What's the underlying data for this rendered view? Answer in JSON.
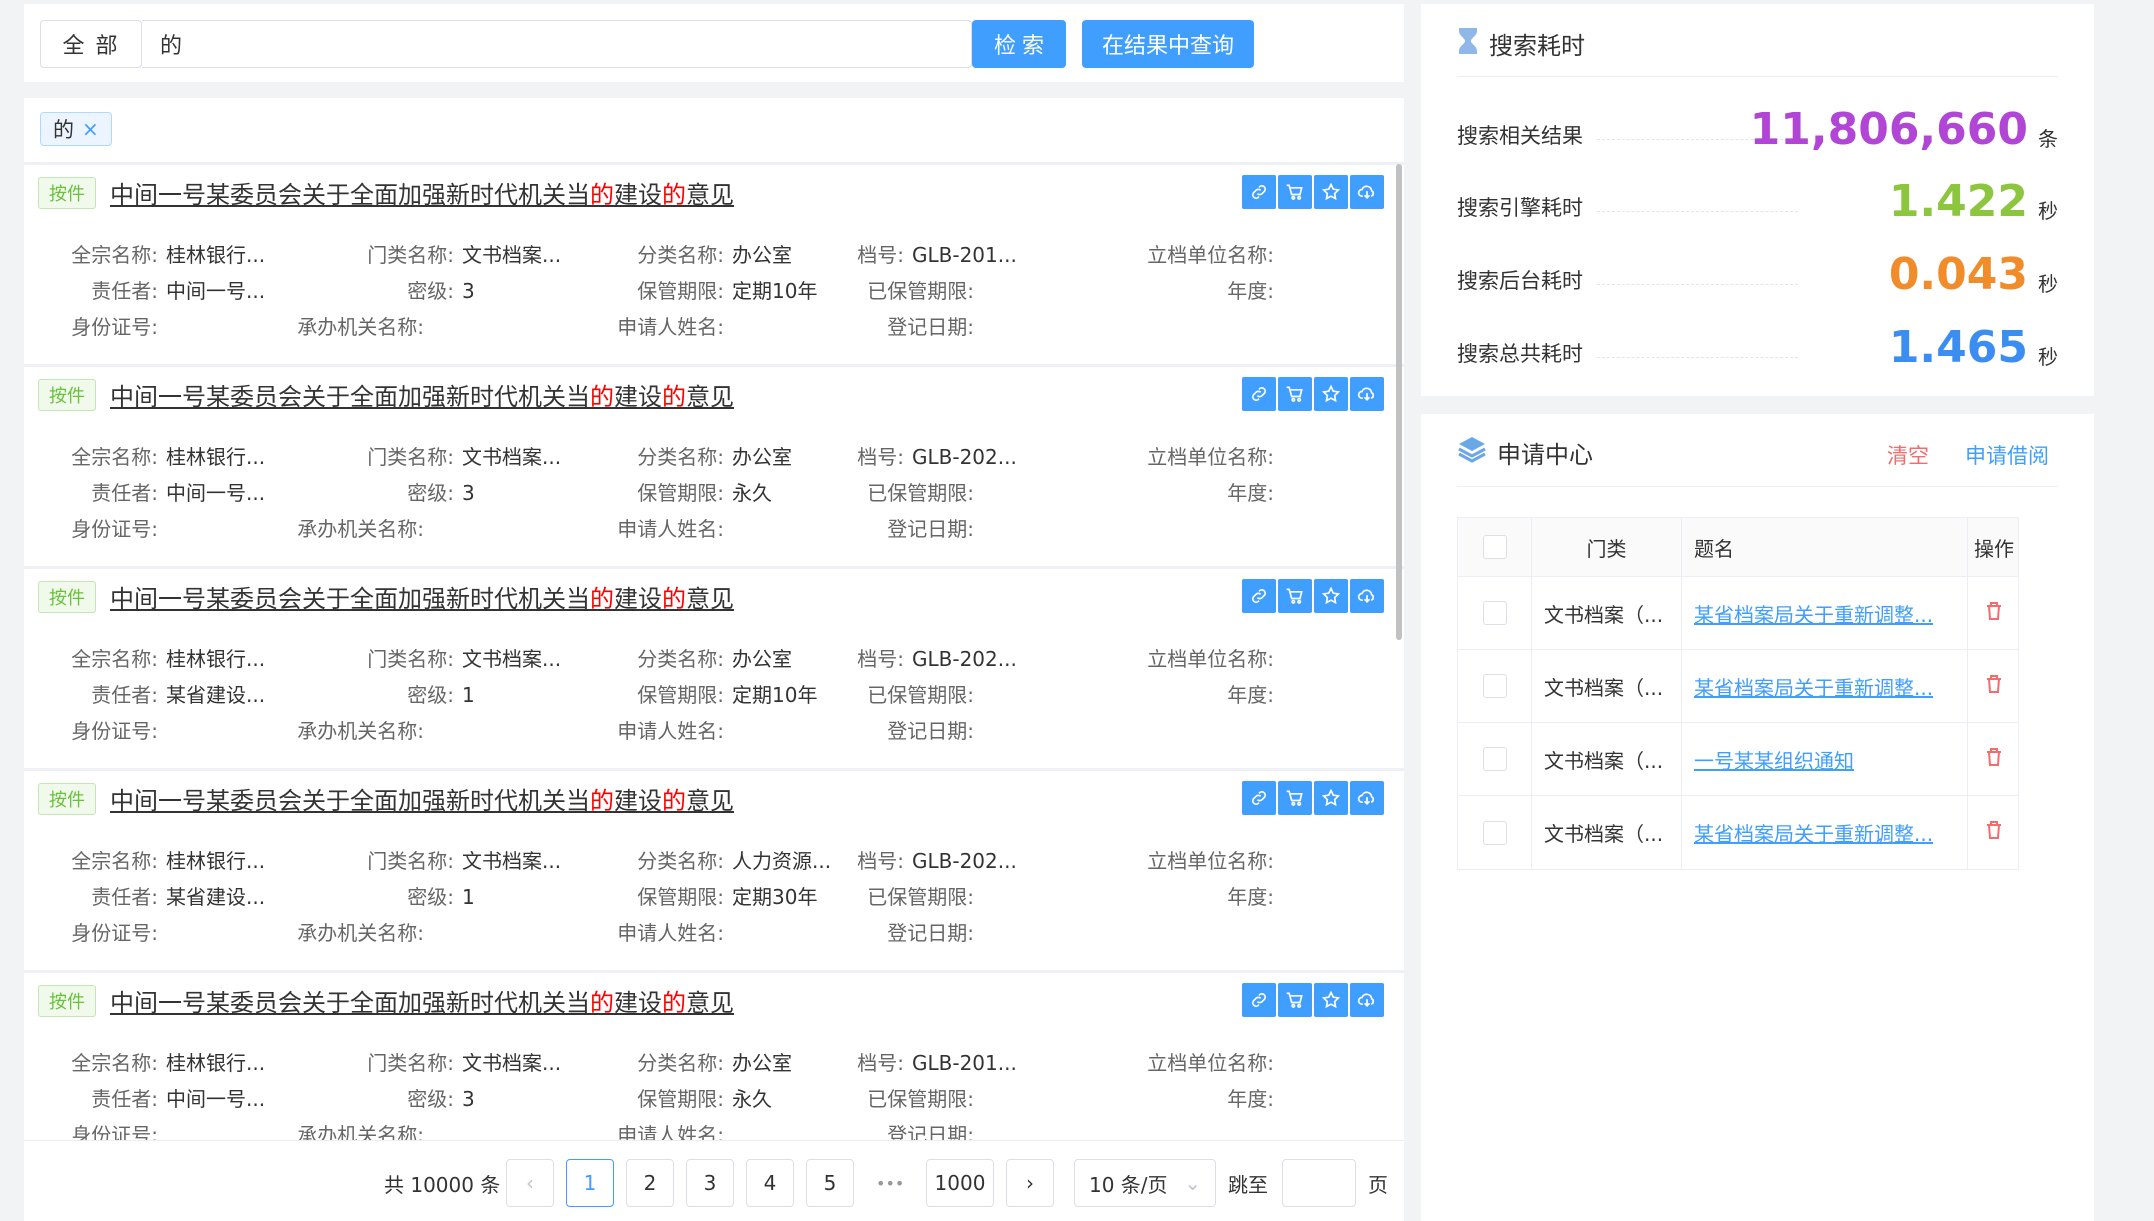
{
  "search": {
    "scope": "全 部",
    "query": "的",
    "search_label": "检 索",
    "refine_label": "在结果中查询"
  },
  "filter_tag": "的",
  "results": [
    {
      "badge": "按件",
      "title_a": "中间一号某委员会关于全面加强新时代机关当",
      "title_b": "的",
      "title_c": "建设",
      "title_d": "的",
      "title_e": "意见",
      "l1": [
        [
          "全宗名称:",
          "桂林银行..."
        ],
        [
          "门类名称:",
          "文书档案..."
        ],
        [
          "分类名称:",
          "办公室"
        ],
        [
          "档号:",
          "GLB-201..."
        ],
        [
          "立档单位名称:",
          ""
        ]
      ],
      "l2": [
        [
          "责任者:",
          "中间一号..."
        ],
        [
          "密级:",
          "3"
        ],
        [
          "保管期限:",
          "定期10年"
        ],
        [
          "已保管期限:",
          ""
        ],
        [
          "年度:",
          ""
        ]
      ],
      "l3": [
        [
          "身份证号:",
          ""
        ],
        [
          "承办机关名称:",
          ""
        ],
        [
          "申请人姓名:",
          ""
        ],
        [
          "登记日期:",
          ""
        ]
      ]
    },
    {
      "badge": "按件",
      "title_a": "中间一号某委员会关于全面加强新时代机关当",
      "title_b": "的",
      "title_c": "建设",
      "title_d": "的",
      "title_e": "意见",
      "l1": [
        [
          "全宗名称:",
          "桂林银行..."
        ],
        [
          "门类名称:",
          "文书档案..."
        ],
        [
          "分类名称:",
          "办公室"
        ],
        [
          "档号:",
          "GLB-202..."
        ],
        [
          "立档单位名称:",
          ""
        ]
      ],
      "l2": [
        [
          "责任者:",
          "中间一号..."
        ],
        [
          "密级:",
          "3"
        ],
        [
          "保管期限:",
          "永久"
        ],
        [
          "已保管期限:",
          ""
        ],
        [
          "年度:",
          ""
        ]
      ],
      "l3": [
        [
          "身份证号:",
          ""
        ],
        [
          "承办机关名称:",
          ""
        ],
        [
          "申请人姓名:",
          ""
        ],
        [
          "登记日期:",
          ""
        ]
      ]
    },
    {
      "badge": "按件",
      "title_a": "中间一号某委员会关于全面加强新时代机关当",
      "title_b": "的",
      "title_c": "建设",
      "title_d": "的",
      "title_e": "意见",
      "l1": [
        [
          "全宗名称:",
          "桂林银行..."
        ],
        [
          "门类名称:",
          "文书档案..."
        ],
        [
          "分类名称:",
          "办公室"
        ],
        [
          "档号:",
          "GLB-202..."
        ],
        [
          "立档单位名称:",
          ""
        ]
      ],
      "l2": [
        [
          "责任者:",
          "某省建设..."
        ],
        [
          "密级:",
          "1"
        ],
        [
          "保管期限:",
          "定期10年"
        ],
        [
          "已保管期限:",
          ""
        ],
        [
          "年度:",
          ""
        ]
      ],
      "l3": [
        [
          "身份证号:",
          ""
        ],
        [
          "承办机关名称:",
          ""
        ],
        [
          "申请人姓名:",
          ""
        ],
        [
          "登记日期:",
          ""
        ]
      ]
    },
    {
      "badge": "按件",
      "title_a": "中间一号某委员会关于全面加强新时代机关当",
      "title_b": "的",
      "title_c": "建设",
      "title_d": "的",
      "title_e": "意见",
      "l1": [
        [
          "全宗名称:",
          "桂林银行..."
        ],
        [
          "门类名称:",
          "文书档案..."
        ],
        [
          "分类名称:",
          "人力资源..."
        ],
        [
          "档号:",
          "GLB-202..."
        ],
        [
          "立档单位名称:",
          ""
        ]
      ],
      "l2": [
        [
          "责任者:",
          "某省建设..."
        ],
        [
          "密级:",
          "1"
        ],
        [
          "保管期限:",
          "定期30年"
        ],
        [
          "已保管期限:",
          ""
        ],
        [
          "年度:",
          ""
        ]
      ],
      "l3": [
        [
          "身份证号:",
          ""
        ],
        [
          "承办机关名称:",
          ""
        ],
        [
          "申请人姓名:",
          ""
        ],
        [
          "登记日期:",
          ""
        ]
      ]
    },
    {
      "badge": "按件",
      "title_a": "中间一号某委员会关于全面加强新时代机关当",
      "title_b": "的",
      "title_c": "建设",
      "title_d": "的",
      "title_e": "意见",
      "l1": [
        [
          "全宗名称:",
          "桂林银行..."
        ],
        [
          "门类名称:",
          "文书档案..."
        ],
        [
          "分类名称:",
          "办公室"
        ],
        [
          "档号:",
          "GLB-201..."
        ],
        [
          "立档单位名称:",
          ""
        ]
      ],
      "l2": [
        [
          "责任者:",
          "中间一号..."
        ],
        [
          "密级:",
          "3"
        ],
        [
          "保管期限:",
          "永久"
        ],
        [
          "已保管期限:",
          ""
        ],
        [
          "年度:",
          ""
        ]
      ],
      "l3": [
        [
          "身份证号:",
          ""
        ],
        [
          "承办机关名称:",
          ""
        ],
        [
          "申请人姓名:",
          ""
        ],
        [
          "登记日期:",
          ""
        ]
      ]
    }
  ],
  "pagination": {
    "total": "共 10000 条",
    "pages": [
      "1",
      "2",
      "3",
      "4",
      "5"
    ],
    "ellipsis": "•••",
    "last": "1000",
    "page_size": "10 条/页",
    "jump_label": "跳至",
    "page_unit": "页",
    "prev": "‹",
    "next": "›"
  },
  "timing": {
    "title": "搜索耗时",
    "stats": [
      {
        "label": "搜索相关结果",
        "value": "11,806,660",
        "unit": "条",
        "color": "#b145d6"
      },
      {
        "label": "搜索引擎耗时",
        "value": "1.422",
        "unit": "秒",
        "color": "#8cc63f"
      },
      {
        "label": "搜索后台耗时",
        "value": "0.043",
        "unit": "秒",
        "color": "#f08c2a"
      },
      {
        "label": "搜索总共耗时",
        "value": "1.465",
        "unit": "秒",
        "color": "#3b8df2"
      }
    ]
  },
  "apply": {
    "title": "申请中心",
    "clear": "清空",
    "borrow": "申请借阅",
    "headers": {
      "category": "门类",
      "name": "题名",
      "op": "操作"
    },
    "rows": [
      {
        "category": "文书档案（...",
        "name": "某省档案局关于重新调整..."
      },
      {
        "category": "文书档案（...",
        "name": "某省档案局关于重新调整..."
      },
      {
        "category": "文书档案（...",
        "name": "一号某某组织通知"
      },
      {
        "category": "文书档案（...",
        "name": "某省档案局关于重新调整..."
      }
    ]
  }
}
